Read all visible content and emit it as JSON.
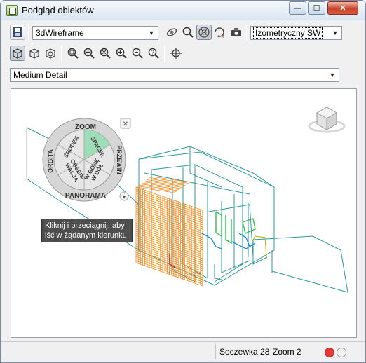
{
  "window": {
    "title": "Podgląd obiektów",
    "minimize_glyph": "—",
    "maximize_glyph": "☐",
    "close_glyph": "✕"
  },
  "toolbar1": {
    "visual_style": "3dWireframe",
    "view": "Izometryczny SW",
    "icons": [
      "save-icon",
      "orbit-icon",
      "zoom-magnifier-icon",
      "steering-wheel-icon",
      "pan-icon",
      "camera-icon"
    ]
  },
  "toolbar2": {
    "icons": [
      "box-view-icon",
      "box-open-icon",
      "box-walk-icon",
      "zoom-realtime-icon",
      "zoom-in-icon",
      "zoom-window-icon",
      "zoom-plus-icon",
      "zoom-minus-icon",
      "zoom-help-icon",
      "target-crosshair-icon"
    ]
  },
  "detail_level": "Medium Detail",
  "wheel": {
    "zoom": "ZOOM",
    "orbit": "ORBITA",
    "pan": "PANORAMA",
    "rewind": "PRZEWIN",
    "center": "ŚRODEK",
    "walk": "SPACER",
    "look": "OBSER-\nWACJA",
    "updown": "W GÓRĘ\nW DÓŁ",
    "close_glyph": "✕",
    "menu_glyph": "▾",
    "walk_highlight": "#9fdcb8"
  },
  "tooltip": "Kliknij i przeciągnij, aby iść w żądanym kierunku",
  "status": {
    "lens": "Soczewka 28",
    "zoom": "Zoom 2"
  },
  "colors": {
    "wire_teal": "#2e9a9a",
    "wire_orange": "#f28a1e",
    "wire_green": "#2bbf4b",
    "wire_blue": "#1f8fe0",
    "status_red": "#e53935"
  }
}
